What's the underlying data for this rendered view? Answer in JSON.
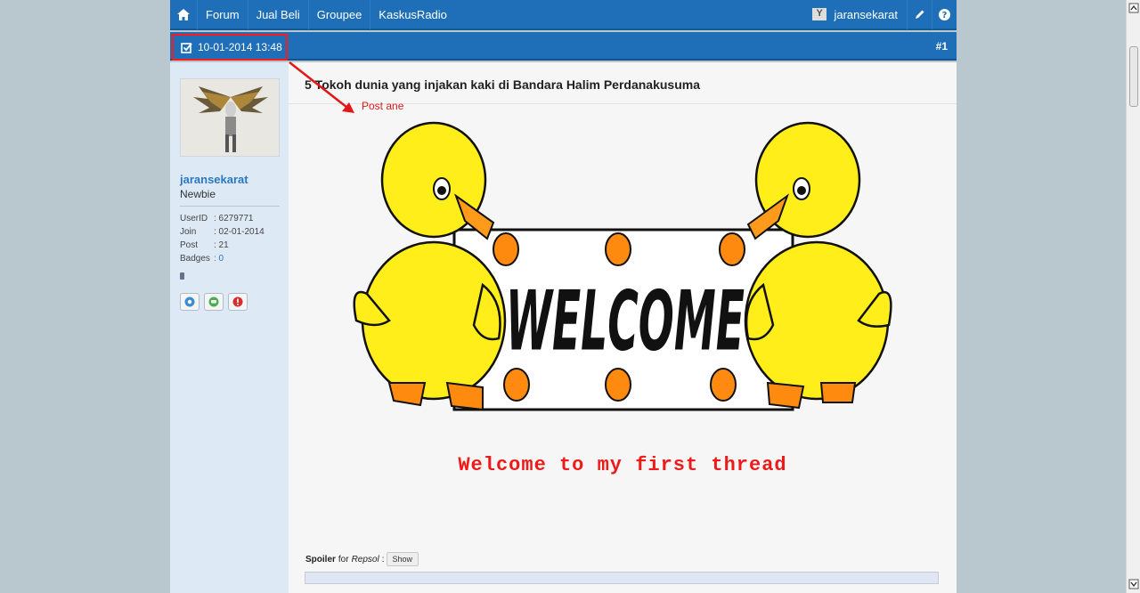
{
  "nav": {
    "items": [
      "Forum",
      "Jual Beli",
      "Groupee",
      "KaskusRadio"
    ],
    "username": "jaransekarat"
  },
  "post": {
    "date": "10-01-2014 13:48",
    "number": "#1",
    "title": "5 Tokoh dunia yang injakan kaki di Bandara Halim Perdanakusuma",
    "annotation": "Post ane",
    "welcome_banner": "WELCOME",
    "welcome_text": "Welcome to my first thread",
    "spoiler_label": "Spoiler",
    "spoiler_for": "for",
    "spoiler_title": "Repsol",
    "spoiler_button": "Show"
  },
  "author": {
    "name": "jaransekarat",
    "rank": "Newbie",
    "stats": [
      {
        "label": "UserID",
        "value": ": 6279771"
      },
      {
        "label": "Join",
        "value": ": 02-01-2014"
      },
      {
        "label": "Post",
        "value": ": 21"
      },
      {
        "label": "Badges",
        "value": ": 0"
      }
    ]
  },
  "colors": {
    "header_blue": "#1e6fb8",
    "sidebar_bg": "#dde9f5",
    "annotation_red": "#ff1a1a",
    "welcome_red": "#ee1a1a",
    "duck_yellow": "#ffee1a"
  }
}
